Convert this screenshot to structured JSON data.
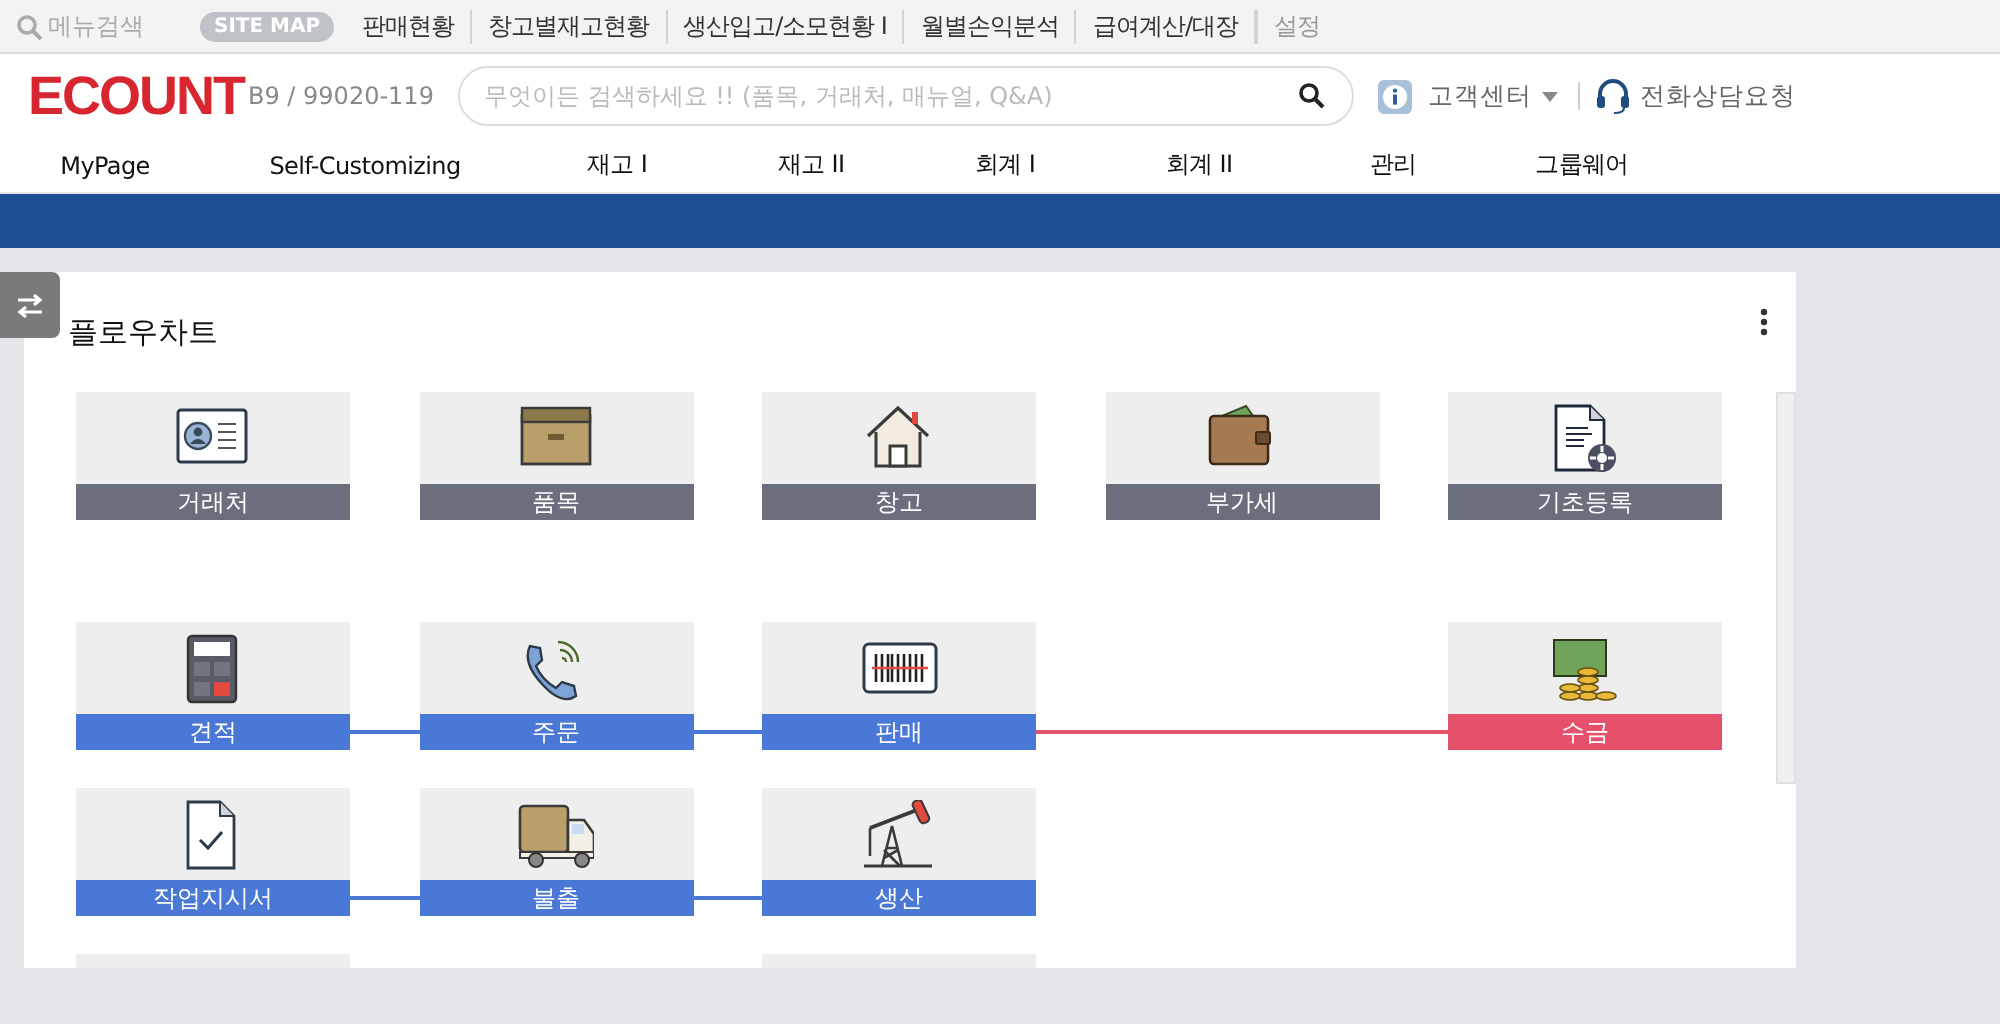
{
  "top_bar": {
    "search": {
      "placeholder": "메뉴검색"
    },
    "site_map": "SITE MAP",
    "links": [
      {
        "label": "판매현황",
        "disabled": false
      },
      {
        "label": "창고별재고현황",
        "disabled": false
      },
      {
        "label": "생산입고/소모현황 I",
        "disabled": false
      },
      {
        "label": "월별손익분석",
        "disabled": false
      },
      {
        "label": "급여계산/대장",
        "disabled": false
      },
      {
        "label": "설정",
        "disabled": true
      }
    ]
  },
  "header": {
    "logo": "ECOUNT",
    "company_code": "B9 / 99020-119",
    "search": {
      "placeholder": "무엇이든 검색하세요 !! (품목, 거래처, 매뉴얼, Q&A)"
    },
    "help_center": "고객센터",
    "phone_consult": "전화상담요청"
  },
  "nav": [
    "MyPage",
    "Self-Customizing",
    "재고 I",
    "재고 II",
    "회계 I",
    "회계 II",
    "관리",
    "그룹웨어"
  ],
  "card": {
    "title": "플로우차트",
    "groups": [
      {
        "rows": [
          {
            "cells": [
              {
                "kind": "node",
                "label": "거래처",
                "color": "#6b6e7d"
              },
              {
                "kind": "node",
                "label": "품목",
                "color": "#6b6e7d"
              },
              {
                "kind": "node",
                "label": "창고",
                "color": "#6b6e7d"
              },
              {
                "kind": "node",
                "label": "부가세",
                "color": "#6b6e7d"
              },
              {
                "kind": "node",
                "label": "기초등록",
                "color": "#6b6e7d"
              }
            ]
          }
        ]
      },
      {
        "rows": [
          {
            "cells": [
              {
                "kind": "node",
                "label": "견적",
                "color": "#4a78d6",
                "link_to_next": {
                  "color": "#4a78d6"
                }
              },
              {
                "kind": "node",
                "label": "주문",
                "color": "#4a78d6",
                "link_to_next": {
                  "color": "#4a78d6"
                }
              },
              {
                "kind": "node",
                "label": "판매",
                "color": "#4a78d6",
                "link_to_next": {
                  "color": "#e5516a"
                }
              },
              {
                "kind": "empty"
              },
              {
                "kind": "node",
                "label": "수금",
                "color": "#e5516a"
              }
            ]
          },
          {
            "cells": [
              {
                "kind": "node",
                "label": "작업지시서",
                "color": "#4a78d6",
                "link_to_next": {
                  "color": "#4a78d6"
                }
              },
              {
                "kind": "node",
                "label": "불출",
                "color": "#4a78d6",
                "link_to_next": {
                  "color": "#4a78d6"
                }
              },
              {
                "kind": "node",
                "label": "생산",
                "color": "#4a78d6"
              },
              {
                "kind": "empty"
              },
              {
                "kind": "empty"
              }
            ]
          },
          {
            "cells": [
              {
                "kind": "cut"
              },
              {
                "kind": "empty"
              },
              {
                "kind": "cut"
              },
              {
                "kind": "empty"
              },
              {
                "kind": "empty"
              }
            ]
          }
        ]
      }
    ]
  }
}
